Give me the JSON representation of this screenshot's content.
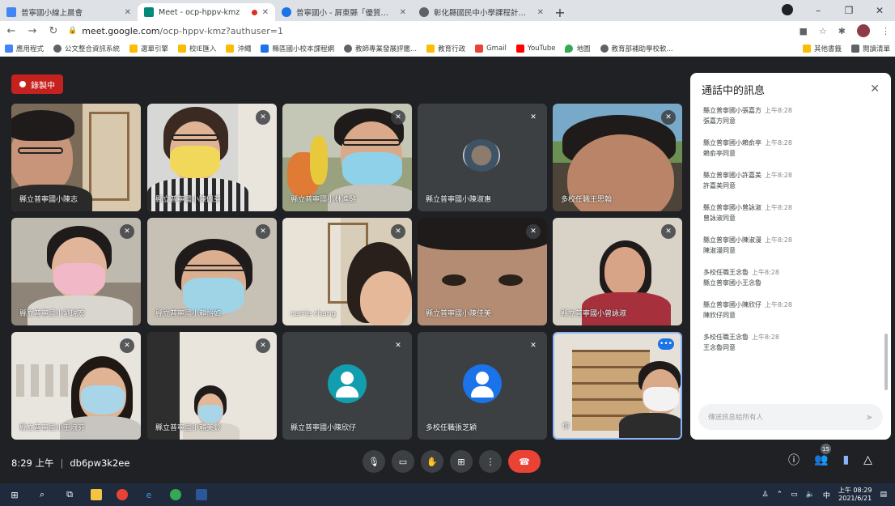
{
  "browser": {
    "tabs": [
      {
        "title": "普寧國小線上晨會",
        "favicon_color": "#4285f4",
        "active": false
      },
      {
        "title": "Meet - ocp-hppv-kmz",
        "favicon_color": "#00897b",
        "active": true
      },
      {
        "title": "普寧國小 - 屏東縣「優質」優勝",
        "favicon_color": "#1a73e8",
        "active": false
      },
      {
        "title": "彰化縣國民中小學課程計畫平台",
        "favicon_color": "#5f6368",
        "active": false
      }
    ],
    "url_host": "meet.google.com",
    "url_path": "/ocp-hppv-kmz?authuser=1",
    "bookmarks": [
      {
        "label": "應用程式",
        "color": "#4285f4"
      },
      {
        "label": "公文整合資訊系統",
        "color": "#5f6368"
      },
      {
        "label": "選單引擎",
        "color": "#fbbc04"
      },
      {
        "label": "校IE匯入",
        "color": "#fbbc04"
      },
      {
        "label": "沖繩",
        "color": "#fbbc04"
      },
      {
        "label": "縣區國小校本課程網",
        "color": "#1a73e8"
      },
      {
        "label": "教師專業發展評鑑...",
        "color": "#5f6368"
      },
      {
        "label": "教育行政",
        "color": "#fbbc04"
      },
      {
        "label": "Gmail",
        "color": "#ea4335"
      },
      {
        "label": "YouTube",
        "color": "#ff0000"
      },
      {
        "label": "地圖",
        "color": "#34a853"
      },
      {
        "label": "教育部補助學校軟...",
        "color": "#5f6368"
      }
    ],
    "bookmarks_right": [
      "其他書籤",
      "閱讀清單"
    ]
  },
  "meet": {
    "recording_label": "錄製中",
    "tiles": [
      {
        "name": "縣立普寧國小陳志",
        "muted": false,
        "scene": "man-shelf"
      },
      {
        "name": "縣立普寧國小陳佩芬",
        "muted": true,
        "scene": "woman-yellow"
      },
      {
        "name": "縣立普寧國小林進發",
        "muted": true,
        "scene": "man-blue-mask"
      },
      {
        "name": "縣立普寧國小陳淑惠",
        "muted": true,
        "scene": "photo"
      },
      {
        "name": "多校任職王思翰",
        "muted": true,
        "scene": "man-close"
      },
      {
        "name": "縣立普寧國小劉瑞宏",
        "muted": true,
        "scene": "woman-pink-mask"
      },
      {
        "name": "縣立普寧國小賴怡如",
        "muted": true,
        "scene": "woman-glasses"
      },
      {
        "name": "carrie chang",
        "muted": true,
        "scene": "woman-side"
      },
      {
        "name": "縣立普寧國小陳佳美",
        "muted": true,
        "scene": "closeup"
      },
      {
        "name": "縣立普寧國小曾詠淑",
        "muted": true,
        "scene": "woman-red"
      },
      {
        "name": "縣立普寧國小王淑芬",
        "muted": true,
        "scene": "woman-room"
      },
      {
        "name": "縣立普寧國小賴美鈴",
        "muted": true,
        "scene": "woman-small"
      },
      {
        "name": "縣立普寧國小陳欣仔",
        "muted": true,
        "scene": "avatar-teal"
      },
      {
        "name": "多校任職張芝穎",
        "muted": true,
        "scene": "avatar-blue"
      },
      {
        "name": "你",
        "muted": false,
        "scene": "self"
      }
    ],
    "chat": {
      "title": "通話中的訊息",
      "messages": [
        {
          "sender": "縣立普寧國小張嘉方",
          "time": "上午8:28",
          "text": "張嘉方同意"
        },
        {
          "sender": "縣立普寧國小賴俞亭",
          "time": "上午8:28",
          "text": "賴俞亭同意"
        },
        {
          "sender": "縣立普寧國小許嘉美",
          "time": "上午8:28",
          "text": "許嘉美同意"
        },
        {
          "sender": "縣立普寧國小曾詠淑",
          "time": "上午8:28",
          "text": "曾詠淑同意"
        },
        {
          "sender": "縣立普寧國小陳淑漫",
          "time": "上午8:28",
          "text": "陳淑漫同意"
        },
        {
          "sender": "多校任職王念魯",
          "time": "上午8:28",
          "text": "縣立普寧國小王念魯"
        },
        {
          "sender": "縣立普寧國小陳欣仔",
          "time": "上午8:28",
          "text": "陳欣仔同意"
        },
        {
          "sender": "多校任職王念魯",
          "time": "上午8:28",
          "text": "王念魯同意"
        }
      ],
      "input_placeholder": "傳送訊息給所有人"
    },
    "time": "8:29 上午",
    "meeting_code": "db6pw3k2ee",
    "participant_count": "15"
  },
  "taskbar": {
    "date": "2021/6/21",
    "time": "上午 08:29",
    "ime": "中"
  }
}
